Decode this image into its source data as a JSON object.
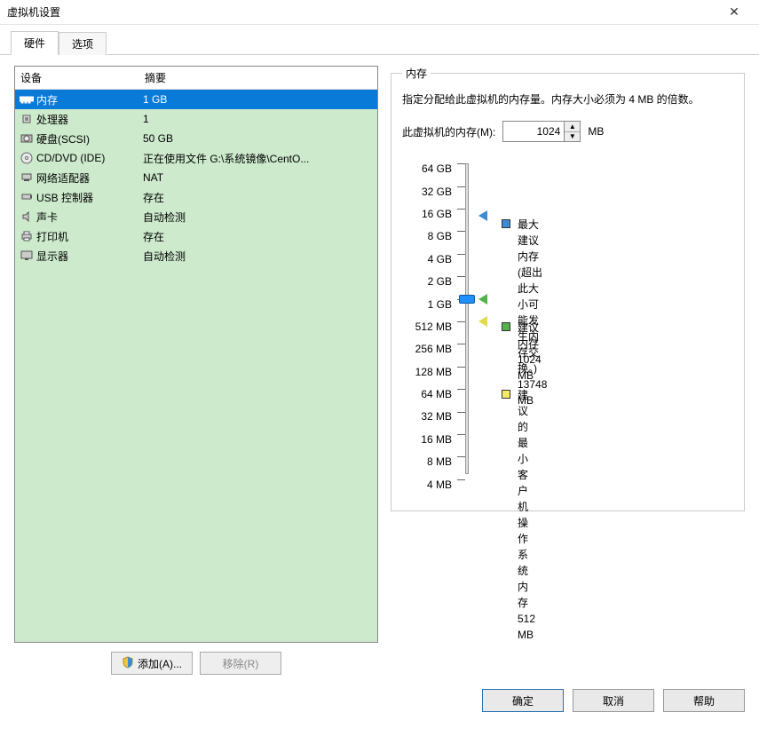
{
  "window": {
    "title": "虚拟机设置"
  },
  "tabs": {
    "hardware": "硬件",
    "options": "选项",
    "active": "hardware"
  },
  "device_table": {
    "headers": {
      "device": "设备",
      "summary": "摘要"
    },
    "rows": [
      {
        "icon": "memory-icon",
        "name": "内存",
        "summary": "1 GB",
        "selected": true
      },
      {
        "icon": "cpu-icon",
        "name": "处理器",
        "summary": "1"
      },
      {
        "icon": "disk-icon",
        "name": "硬盘(SCSI)",
        "summary": "50 GB"
      },
      {
        "icon": "cd-icon",
        "name": "CD/DVD (IDE)",
        "summary": "正在使用文件 G:\\系统镜像\\CentO..."
      },
      {
        "icon": "network-icon",
        "name": "网络适配器",
        "summary": "NAT"
      },
      {
        "icon": "usb-icon",
        "name": "USB 控制器",
        "summary": "存在"
      },
      {
        "icon": "sound-icon",
        "name": "声卡",
        "summary": "自动检测"
      },
      {
        "icon": "printer-icon",
        "name": "打印机",
        "summary": "存在"
      },
      {
        "icon": "display-icon",
        "name": "显示器",
        "summary": "自动检测"
      }
    ],
    "add_button": "添加(A)...",
    "remove_button": "移除(R)"
  },
  "memory_panel": {
    "title": "内存",
    "description": "指定分配给此虚拟机的内存量。内存大小必须为 4 MB 的倍数。",
    "field_label": "此虚拟机的内存(M):",
    "value": "1024",
    "unit": "MB",
    "tick_labels": [
      "64 GB",
      "32 GB",
      "16 GB",
      "8 GB",
      "4 GB",
      "2 GB",
      "1 GB",
      "512 MB",
      "256 MB",
      "128 MB",
      "64 MB",
      "32 MB",
      "16 MB",
      "8 MB",
      "4 MB"
    ],
    "slider_tick_index": 6,
    "markers": {
      "max": {
        "tick_index": 2.3,
        "title": "最大建议内存",
        "note": "(超出此大小可能发生内存交换。)",
        "value": "13748 MB"
      },
      "rec": {
        "tick_index": 6,
        "title": "建议内存",
        "value": "1024 MB"
      },
      "min": {
        "tick_index": 7,
        "title": "建议的最小客户机操作系统内存",
        "value": "512 MB"
      }
    }
  },
  "dialog_buttons": {
    "ok": "确定",
    "cancel": "取消",
    "help": "帮助"
  }
}
